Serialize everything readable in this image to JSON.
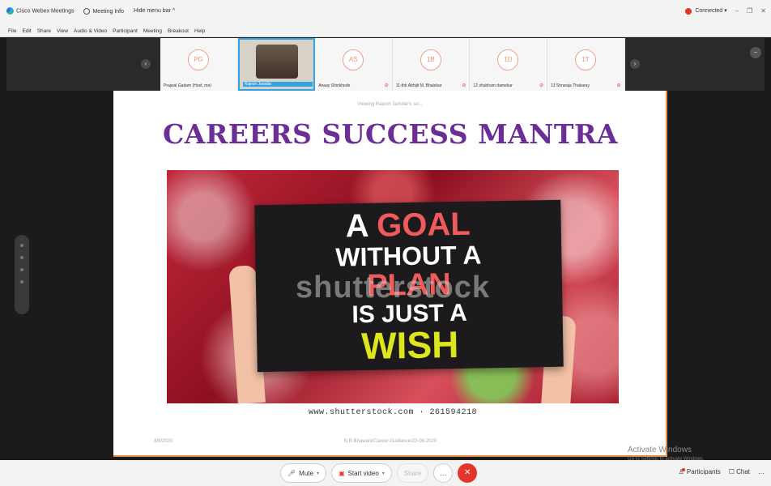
{
  "titlebar": {
    "app_name": "Cisco Webex Meetings",
    "meeting_info": "Meeting Info",
    "hide_menu": "Hide menu bar ^",
    "connection": "Connected ▾",
    "min": "–",
    "restore": "❐",
    "close": "✕"
  },
  "menubar": {
    "items": [
      "File",
      "Edit",
      "Share",
      "View",
      "Audio & Video",
      "Participant",
      "Meeting",
      "Breakout",
      "Help"
    ]
  },
  "participants": [
    {
      "initials": "PG",
      "name": "Prajwal Gadam (Host, me)",
      "active": false
    },
    {
      "initials": "",
      "name": "Rajesh Jamdar",
      "active": true
    },
    {
      "initials": "AS",
      "name": "Anaay Shinkhede",
      "active": false
    },
    {
      "initials": "1B",
      "name": "11-thb Abhijit M. Bhalekar",
      "active": false
    },
    {
      "initials": "1D",
      "name": "12 shubham damekar",
      "active": false
    },
    {
      "initials": "1T",
      "name": "13 Shraraja Thakaray",
      "active": false
    }
  ],
  "slide": {
    "viewing": "Viewing Rajesh Jamdar's scr...",
    "title": "CAREERS SUCCESS MANTRA",
    "board_lines": [
      "A",
      "GOAL",
      "WITHOUT A",
      "PLAN",
      "IS JUST A",
      "WISH"
    ],
    "watermark": "shutterstock",
    "credit": "www.shutterstock.com · 261594218",
    "footer_date": "8/8/2020",
    "footer_text": "N.R.Bhawani/Career Guidance/23-08-2020"
  },
  "os_overlay": {
    "activate": "Activate Windows",
    "activate_sub": "Go to Settings to activate Windows."
  },
  "controls": {
    "mute": "Mute",
    "start_video": "Start video",
    "share": "Share",
    "more": "…",
    "end": "✕",
    "participants": "Participants",
    "chat": "Chat",
    "overflow": "…"
  }
}
